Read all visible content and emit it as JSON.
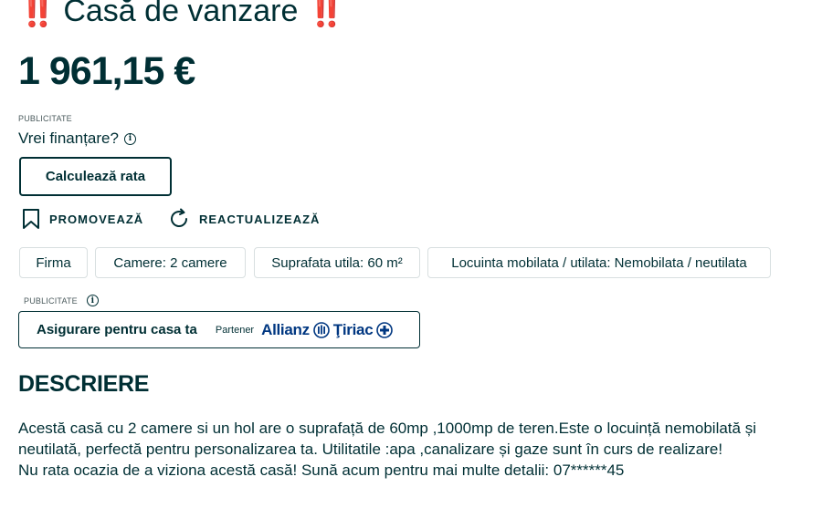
{
  "listing": {
    "title": "Casă de vanzare",
    "title_marker": "‼️",
    "price": "1 961,15 €"
  },
  "finance": {
    "ad_label": "PUBLICITATE",
    "question": "Vrei finanțare?",
    "info_icon": "i",
    "calc_button": "Calculează rata"
  },
  "actions": {
    "promote": "PROMOVEAZĂ",
    "refresh": "REACTUALIZEAZĂ"
  },
  "tags": [
    "Firma",
    "Camere: 2 camere",
    "Suprafata utila: 60 m²",
    "Locuinta mobilata / utilata: Nemobilata / neutilata"
  ],
  "insurance": {
    "ad_label": "PUBLICITATE",
    "label": "Asigurare pentru casa ta",
    "partner_label": "Partener",
    "partner_brand_1": "Allianz",
    "partner_brand_2": "Ţiriac"
  },
  "description": {
    "heading": "DESCRIERE",
    "lines": [
      "Acestă casă cu 2 camere si un hol are o suprafață de 60mp ,1000mp de teren.Este o locuință nemobilată și",
      "neutilată, perfectă pentru personalizarea ta. Utilitatile :apa ,canalizare și gaze sunt în curs de realizare!",
      "Nu rata ocazia de a viziona acestă casă! Sună acum pentru mai multe detalii: 07******45"
    ]
  },
  "colors": {
    "text": "#002f34",
    "accent_marker": "#e0245e",
    "allianz_blue": "#003781",
    "tag_border": "#d8dfe0"
  },
  "icons": [
    "double-exclamation-icon",
    "info-icon",
    "bookmark-icon",
    "refresh-icon",
    "allianz-eagle-icon",
    "tiriac-cross-icon"
  ]
}
